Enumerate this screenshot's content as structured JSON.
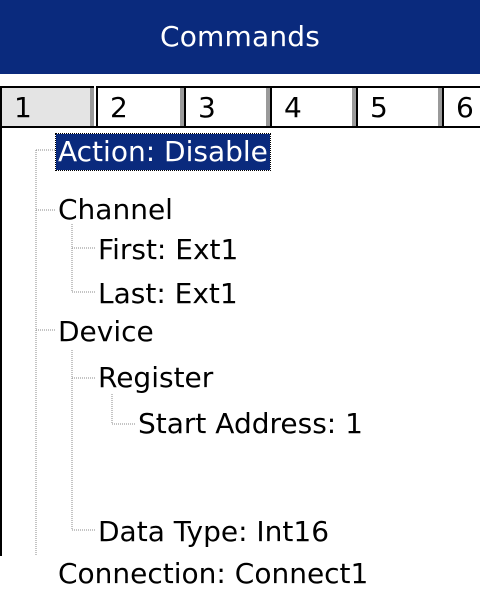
{
  "window": {
    "title": "Commands"
  },
  "tabs": [
    {
      "label": "1",
      "selected": true
    },
    {
      "label": "2",
      "selected": false
    },
    {
      "label": "3",
      "selected": false
    },
    {
      "label": "4",
      "selected": false
    },
    {
      "label": "5",
      "selected": false
    },
    {
      "label": "6",
      "selected": false
    }
  ],
  "tree": {
    "action": "Action: Disable",
    "channel": "Channel",
    "channel_first": "First: Ext1",
    "channel_last": "Last: Ext1",
    "device": "Device",
    "register": "Register",
    "start_address": "Start Address: 1",
    "data_type": "Data Type: Int16",
    "connection": "Connection: Connect1"
  },
  "colors": {
    "title_bg": "#0a2a7d",
    "selection_bg": "#0a2a7d",
    "selected_tab_bg": "#e4e4e4"
  }
}
